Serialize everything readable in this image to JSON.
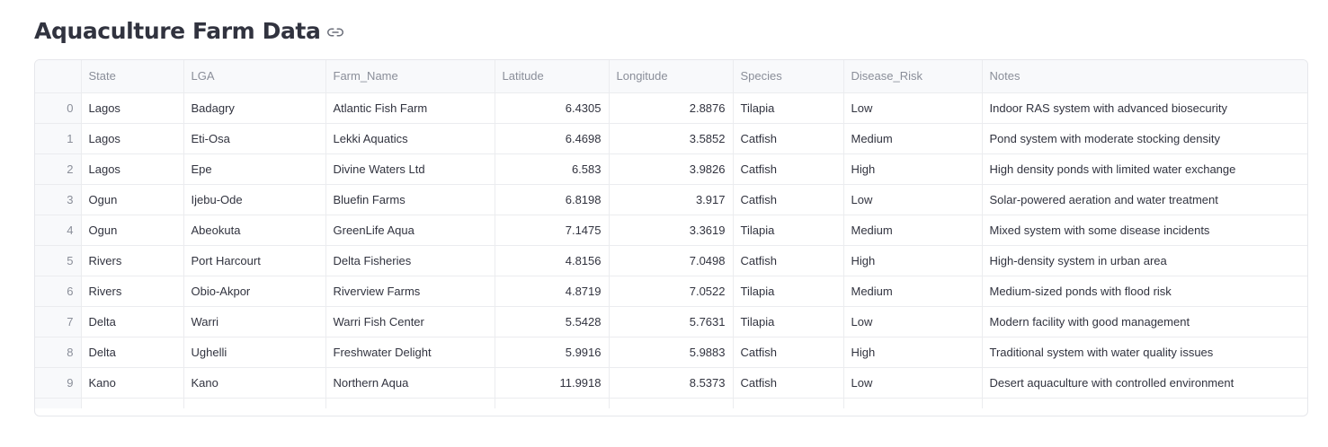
{
  "title": "Aquaculture Farm Data",
  "icons": {
    "anchor": "link-icon"
  },
  "table": {
    "columns": [
      "",
      "State",
      "LGA",
      "Farm_Name",
      "Latitude",
      "Longitude",
      "Species",
      "Disease_Risk",
      "Notes"
    ],
    "rows": [
      [
        "0",
        "Lagos",
        "Badagry",
        "Atlantic Fish Farm",
        "6.4305",
        "2.8876",
        "Tilapia",
        "Low",
        "Indoor RAS system with advanced biosecurity"
      ],
      [
        "1",
        "Lagos",
        "Eti-Osa",
        "Lekki Aquatics",
        "6.4698",
        "3.5852",
        "Catfish",
        "Medium",
        "Pond system with moderate stocking density"
      ],
      [
        "2",
        "Lagos",
        "Epe",
        "Divine Waters Ltd",
        "6.583",
        "3.9826",
        "Catfish",
        "High",
        "High density ponds with limited water exchange"
      ],
      [
        "3",
        "Ogun",
        "Ijebu-Ode",
        "Bluefin Farms",
        "6.8198",
        "3.917",
        "Catfish",
        "Low",
        "Solar-powered aeration and water treatment"
      ],
      [
        "4",
        "Ogun",
        "Abeokuta",
        "GreenLife Aqua",
        "7.1475",
        "3.3619",
        "Tilapia",
        "Medium",
        "Mixed system with some disease incidents"
      ],
      [
        "5",
        "Rivers",
        "Port Harcourt",
        "Delta Fisheries",
        "4.8156",
        "7.0498",
        "Catfish",
        "High",
        "High-density system in urban area"
      ],
      [
        "6",
        "Rivers",
        "Obio-Akpor",
        "Riverview Farms",
        "4.8719",
        "7.0522",
        "Tilapia",
        "Medium",
        "Medium-sized ponds with flood risk"
      ],
      [
        "7",
        "Delta",
        "Warri",
        "Warri Fish Center",
        "5.5428",
        "5.7631",
        "Tilapia",
        "Low",
        "Modern facility with good management"
      ],
      [
        "8",
        "Delta",
        "Ughelli",
        "Freshwater Delight",
        "5.9916",
        "5.9883",
        "Catfish",
        "High",
        "Traditional system with water quality issues"
      ],
      [
        "9",
        "Kano",
        "Kano",
        "Northern Aqua",
        "11.9918",
        "8.5373",
        "Catfish",
        "Low",
        "Desert aquaculture with controlled environment"
      ]
    ]
  }
}
